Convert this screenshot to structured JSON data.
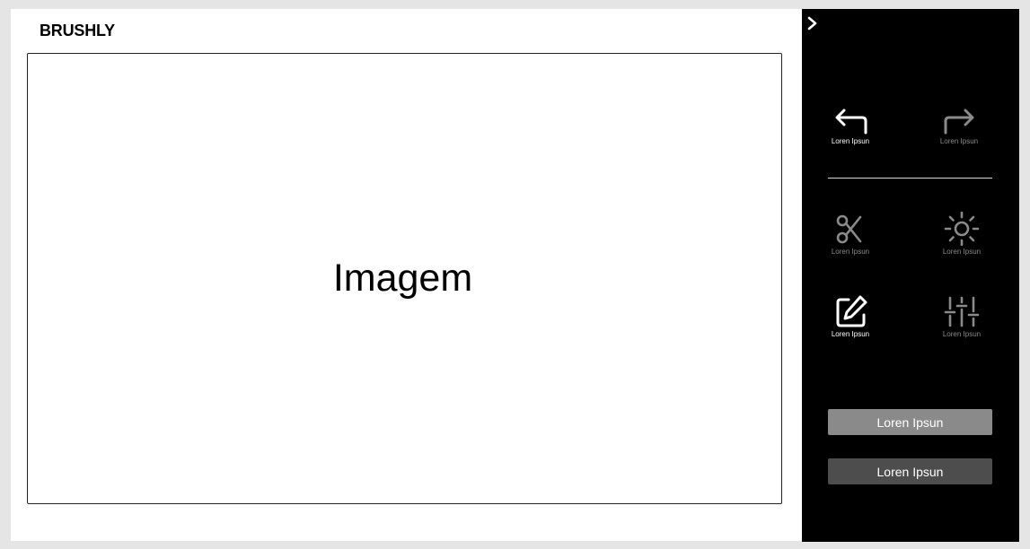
{
  "app": {
    "title": "BRUSHLY"
  },
  "canvas": {
    "placeholder": "Imagem"
  },
  "sidebar": {
    "collapse_icon": "chevron-right-icon",
    "tools": [
      {
        "icon": "undo-icon",
        "label": "Loren Ipsun",
        "state": "active"
      },
      {
        "icon": "redo-icon",
        "label": "Loren Ipsun",
        "state": "disabled"
      },
      {
        "icon": "scissors-icon",
        "label": "Loren Ipsun",
        "state": "inactive"
      },
      {
        "icon": "sun-icon",
        "label": "Loren Ipsun",
        "state": "inactive"
      },
      {
        "icon": "edit-icon",
        "label": "Loren Ipsun",
        "state": "active"
      },
      {
        "icon": "sliders-icon",
        "label": "Loren Ipsun",
        "state": "inactive"
      }
    ],
    "buttons": {
      "primary_label": "Loren Ipsun",
      "secondary_label": "Loren Ipsun"
    }
  },
  "colors": {
    "sidebar_bg": "#000000",
    "active_icon": "#ffffff",
    "dim_icon": "#8a8a8a",
    "primary_button": "#8a8a8a",
    "secondary_button": "#4d4d4d"
  }
}
